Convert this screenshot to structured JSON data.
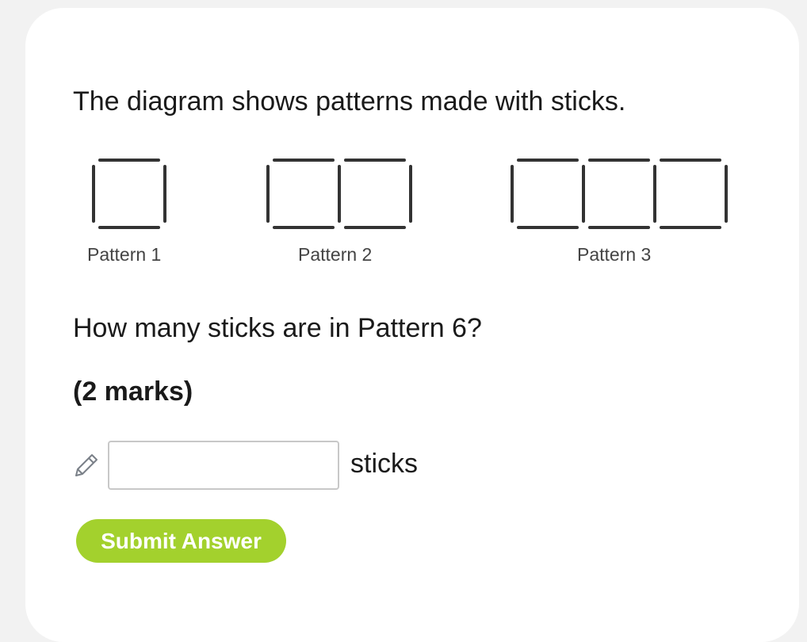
{
  "question": {
    "intro": "The diagram shows patterns made with sticks.",
    "prompt": "How many sticks are in Pattern 6?",
    "marks": "(2 marks)"
  },
  "diagram": {
    "patterns": [
      {
        "label": "Pattern 1",
        "squares": 1
      },
      {
        "label": "Pattern 2",
        "squares": 2
      },
      {
        "label": "Pattern 3",
        "squares": 3
      }
    ]
  },
  "answer": {
    "value": "",
    "placeholder": "",
    "unit": "sticks",
    "edit_icon": "pencil-icon"
  },
  "submit": {
    "label": "Submit Answer",
    "color": "#a3d12d"
  }
}
